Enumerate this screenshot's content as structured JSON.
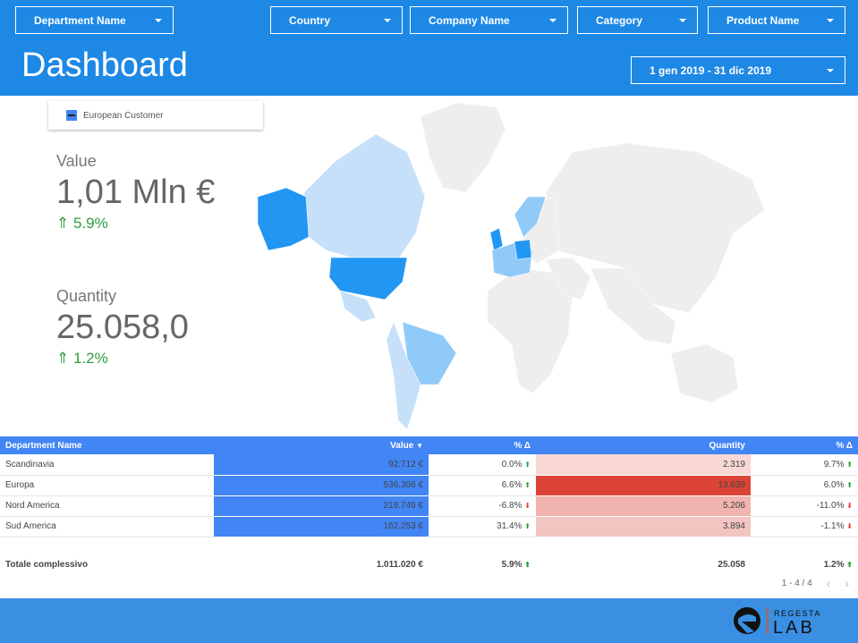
{
  "filters": [
    {
      "label": "Department Name"
    },
    {
      "label": "Country"
    },
    {
      "label": "Company Name"
    },
    {
      "label": "Category"
    },
    {
      "label": "Product Name"
    }
  ],
  "header": {
    "title": "Dashboard",
    "date_range": "1 gen 2019 - 31 dic 2019"
  },
  "map": {
    "legend": "European Customer",
    "colors": {
      "high": "#2196f3",
      "mid": "#90caf9",
      "low": "#c6e0fa",
      "none": "#eeeeee"
    }
  },
  "kpis": [
    {
      "label": "Value",
      "value": "1,01 Mln €",
      "delta": "5.9%",
      "trend": "up"
    },
    {
      "label": "Quantity",
      "value": "25.058,0",
      "delta": "1.2%",
      "trend": "up"
    }
  ],
  "table": {
    "headers": [
      "Department Name",
      "Value",
      "% Δ",
      "Quantity",
      "% Δ"
    ],
    "sort_icon": "caret-down",
    "rows": [
      {
        "name": "Scandinavia",
        "value": "92.712 €",
        "vd": "0.0%",
        "vt": "up",
        "qty": "2.319",
        "qd": "9.7%",
        "qt": "up",
        "qcolor": "#f8d7d4"
      },
      {
        "name": "Europa",
        "value": "536.306 €",
        "vd": "6.6%",
        "vt": "up",
        "qty": "13.639",
        "qd": "6.0%",
        "qt": "up",
        "qcolor": "#db4437"
      },
      {
        "name": "Nord America",
        "value": "219.749 €",
        "vd": "-6.8%",
        "vt": "down",
        "qty": "5.206",
        "qd": "-11.0%",
        "qt": "down",
        "qcolor": "#f0b3ad"
      },
      {
        "name": "Sud America",
        "value": "162.253 €",
        "vd": "31.4%",
        "vt": "up",
        "qty": "3.894",
        "qd": "-1.1%",
        "qt": "down",
        "qcolor": "#f3c5c0"
      }
    ],
    "total": {
      "label": "Totale complessivo",
      "value": "1.011.020 €",
      "vd": "5.9%",
      "qty": "25.058",
      "qd": "1.2%"
    },
    "pagination": "1 - 4 / 4"
  },
  "footer": {
    "logo_text": "REGESTA LAB"
  }
}
